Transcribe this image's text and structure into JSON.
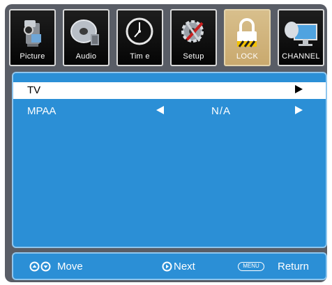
{
  "tabs": [
    {
      "label": "Picture",
      "icon": "camera-icon"
    },
    {
      "label": "Audio",
      "icon": "disc-icon"
    },
    {
      "label": "Tim e",
      "icon": "clock-icon"
    },
    {
      "label": "Setup",
      "icon": "gear-icon"
    },
    {
      "label": "LOCK",
      "icon": "lock-icon"
    },
    {
      "label": "CHANNEL",
      "icon": "satellite-dish-icon"
    }
  ],
  "active_tab": "LOCK",
  "menu": {
    "rows": [
      {
        "label": "TV",
        "selected": true
      },
      {
        "label": "MPAA",
        "value": "N/A",
        "selected": false
      }
    ]
  },
  "footer": {
    "move_label": "Move",
    "next_label": "Next",
    "menu_key": "MENU",
    "return_label": "Return"
  },
  "colors": {
    "panel": "#2b8fd6",
    "frame": "#595d66",
    "active_tab": "#c9a96e"
  }
}
